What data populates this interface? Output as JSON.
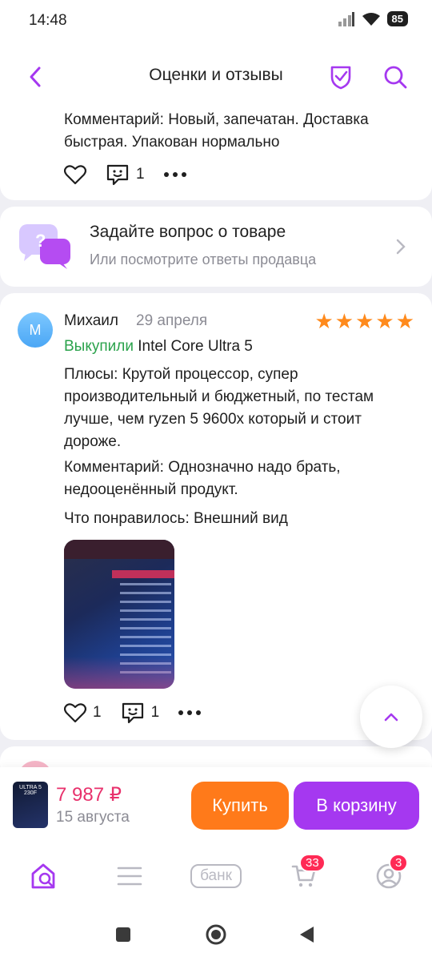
{
  "status": {
    "time": "14:48",
    "battery": "85"
  },
  "header": {
    "title": "Оценки и отзывы"
  },
  "prev_review": {
    "comment": "Комментарий: Новый, запечатан. Доставка быстрая. Упакован нормально",
    "comments_count": "1"
  },
  "ask": {
    "title": "Задайте вопрос о товаре",
    "subtitle": "Или посмотрите ответы продавца"
  },
  "review": {
    "avatar_letter": "М",
    "author": "Михаил",
    "date": "29 апреля",
    "rating": 5,
    "bought_label": "Выкупили",
    "variant": "Intel Core Ultra 5",
    "pros": "Плюсы: Крутой процессор, супер производительный и бюджетный, по тестам лучше, чем ryzen 5 9600x который и стоит дороже.",
    "comment": "Комментарий: Однозначно надо брать, недооценённый продукт.",
    "liked": "Что понравилось: Внешний вид",
    "likes_count": "1",
    "comments_count": "1"
  },
  "buy": {
    "thumb_text": "ULTRA 5 230F",
    "price": "7 987 ₽",
    "delivery": "15 августа",
    "buy_label": "Купить",
    "cart_label": "В корзину"
  },
  "nav": {
    "bank_label": "банк",
    "cart_badge": "33",
    "profile_badge": "3"
  },
  "colors": {
    "accent": "#a538f0",
    "price": "#e8316c",
    "buy_button": "#ff7a1a",
    "stars": "#ff8a1c",
    "bought": "#2aa24b"
  }
}
